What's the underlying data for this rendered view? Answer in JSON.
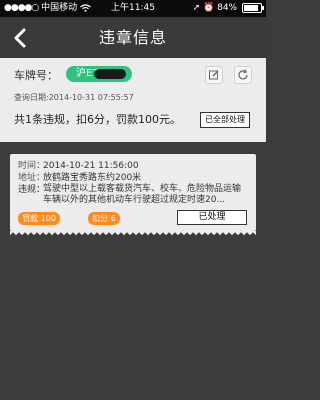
{
  "status_bar": {
    "carrier": "中国移动",
    "time": "上午11:45",
    "battery_percent": "84%",
    "battery_level": 0.84
  },
  "nav": {
    "title": "违章信息"
  },
  "summary": {
    "plate_label": "车牌号：",
    "plate_value": "沪ET",
    "query_date": "查询日期:2014-10-31 07:55:57",
    "summary_text": "共1条违规，扣6分，罚款100元。",
    "handle_all_label": "已全部处理"
  },
  "violation": {
    "time_label": "时间：",
    "time_value": "2014-10-21 11:56:00",
    "location_label": "地址：",
    "location_value": "放鹤路宝秀路东约200米",
    "violation_label": "违规：",
    "violation_text": "驾驶中型以上载客载货汽车、校车、危险物品运输车辆以外的其他机动车行驶超过规定时速20...",
    "fine_badge": "罚款 100",
    "points_badge": "扣分 6",
    "status_label": "已处理"
  }
}
